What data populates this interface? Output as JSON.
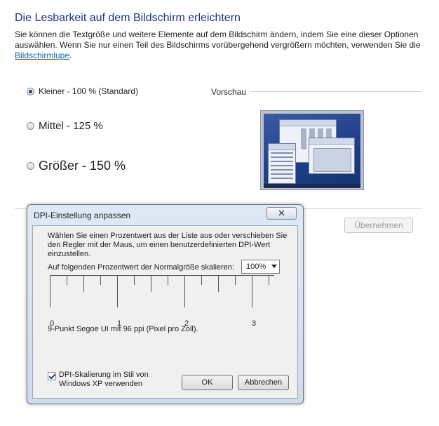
{
  "page": {
    "title": "Die Lesbarkeit auf dem Bildschirm erleichtern",
    "description_text": "Sie können die Textgröße und weitere Elemente auf dem Bildschirm ändern, indem Sie eine dieser Optionen auswählen. Wenn Sie nur einen Teil des Bildschirms vorübergehend vergrößern möchten, verwenden Sie die",
    "link_text": "Bildschirmlupe",
    "link_suffix": ".",
    "options": [
      {
        "label": "Kleiner - 100 % (Standard)",
        "checked": true
      },
      {
        "label": "Mittel - 125 %",
        "checked": false
      },
      {
        "label": "Größer - 150 %",
        "checked": false
      }
    ],
    "preview_label": "Vorschau",
    "apply_button": "Übernehmen"
  },
  "dialog": {
    "title": "DPI-Einstellung anpassen",
    "close_glyph": "✕",
    "instructions": "Wählen Sie einen Prozentwert aus der Liste aus oder verschieben Sie den Regler mit der Maus, um einen benutzerdefinierten DPI-Wert einzustellen.",
    "scale_label": "Auf folgenden Prozentwert der Normalgröße skalieren:",
    "scale_value": "100%",
    "ruler_labels": [
      "0",
      "1",
      "2",
      "3"
    ],
    "info_text": "9-Punkt Segoe UI mit 96 ppi (Pixel pro Zoll).",
    "checkbox_label": "DPI-Skalierung im Stil von Windows XP verwenden",
    "checkbox_checked": true,
    "ok_button": "OK",
    "cancel_button": "Abbrechen"
  },
  "colors": {
    "title": "#1e3287",
    "link": "#0066cc",
    "dialog_frame": "#d4e0ef"
  }
}
